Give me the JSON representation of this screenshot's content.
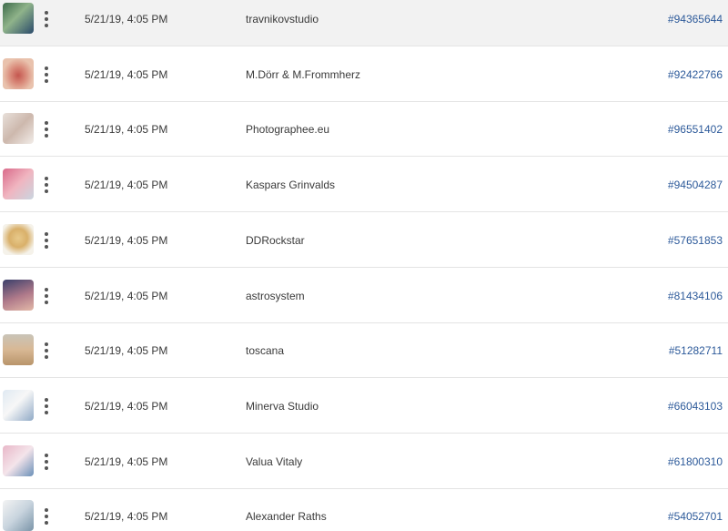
{
  "rows": [
    {
      "date": "5/21/19, 4:05 PM",
      "artist": "travnikovstudio",
      "asset_id": "#94365644",
      "thumb": {
        "bg": "linear-gradient(135deg,#3d6a4a 0%,#8fb38a 45%,#2a4a6a 100%)",
        "icon": "photo-thumbnail-icon"
      }
    },
    {
      "date": "5/21/19, 4:05 PM",
      "artist": "M.Dörr & M.Frommherz",
      "asset_id": "#92422766",
      "thumb": {
        "bg": "radial-gradient(ellipse at 50% 55%,#c4574f 0%,#d98a7a 35%,#e9c2ad 70%)",
        "icon": "photo-thumbnail-icon"
      }
    },
    {
      "date": "5/21/19, 4:05 PM",
      "artist": "Photographee.eu",
      "asset_id": "#96551402",
      "thumb": {
        "bg": "linear-gradient(135deg,#e8e0da 0%,#cdb8ad 50%,#f2ede9 100%)",
        "icon": "photo-thumbnail-icon"
      }
    },
    {
      "date": "5/21/19, 4:05 PM",
      "artist": "Kaspars Grinvalds",
      "asset_id": "#94504287",
      "thumb": {
        "bg": "linear-gradient(135deg,#d96a8a 0%,#f0b5c0 50%,#c9d6e0 100%)",
        "icon": "photo-thumbnail-icon"
      }
    },
    {
      "date": "5/21/19, 4:05 PM",
      "artist": "DDRockstar",
      "asset_id": "#57651853",
      "thumb": {
        "bg": "radial-gradient(circle at 50% 45%,#e8c98a 0%,#d9b06a 40%,#f5f2ea 75%)",
        "icon": "photo-thumbnail-icon"
      }
    },
    {
      "date": "5/21/19, 4:05 PM",
      "artist": "astrosystem",
      "asset_id": "#81434106",
      "thumb": {
        "bg": "linear-gradient(160deg,#3a3f6a 0%,#b07a8a 55%,#e3b9a8 100%)",
        "icon": "photo-thumbnail-icon"
      }
    },
    {
      "date": "5/21/19, 4:05 PM",
      "artist": "toscana",
      "asset_id": "#51282711",
      "thumb": {
        "bg": "linear-gradient(180deg,#c9c4b8 0%,#d8b894 50%,#b8946a 100%)",
        "icon": "photo-thumbnail-icon"
      }
    },
    {
      "date": "5/21/19, 4:05 PM",
      "artist": "Minerva Studio",
      "asset_id": "#66043103",
      "thumb": {
        "bg": "linear-gradient(135deg,#dfe9f2 0%,#f7f7f7 45%,#8fa9c6 100%)",
        "icon": "photo-thumbnail-icon"
      }
    },
    {
      "date": "5/21/19, 4:05 PM",
      "artist": "Valua Vitaly",
      "asset_id": "#61800310",
      "thumb": {
        "bg": "linear-gradient(135deg,#e8b7c8 0%,#f4e4ea 50%,#6a90b8 100%)",
        "icon": "photo-thumbnail-icon"
      }
    },
    {
      "date": "5/21/19, 4:05 PM",
      "artist": "Alexander Raths",
      "asset_id": "#54052701",
      "thumb": {
        "bg": "linear-gradient(135deg,#f3f3f3 0%,#c8d4de 50%,#7a94a8 100%)",
        "icon": "photo-thumbnail-icon"
      }
    }
  ],
  "more_menu_icon": "more-vertical-icon",
  "colors": {
    "link": "#2d5a9a",
    "text": "#3a3a3a",
    "row_highlight": "#f2f2f2",
    "divider": "#e4e4e4"
  }
}
